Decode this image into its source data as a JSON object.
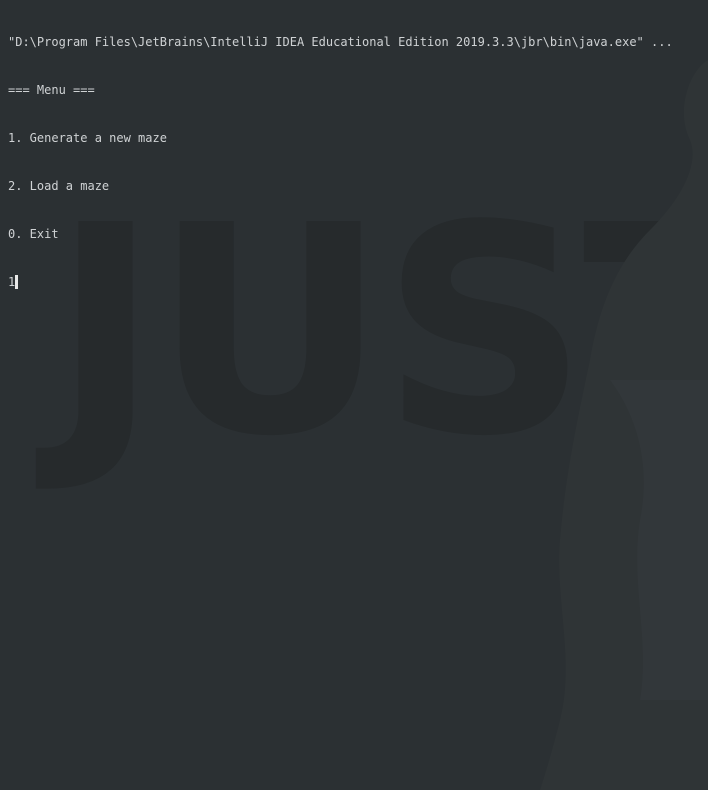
{
  "console": {
    "command_line": "\"D:\\Program Files\\JetBrains\\IntelliJ IDEA Educational Edition 2019.3.3\\jbr\\bin\\java.exe\" ...",
    "menu_header": "=== Menu ===",
    "menu_items": [
      "1. Generate a new maze",
      "2. Load a maze",
      "0. Exit"
    ],
    "input_value": "1"
  },
  "background": {
    "watermark_text": "JUST"
  },
  "colors": {
    "background": "#2b3033",
    "text": "#cfd2d4",
    "watermark": "#262a2c"
  }
}
